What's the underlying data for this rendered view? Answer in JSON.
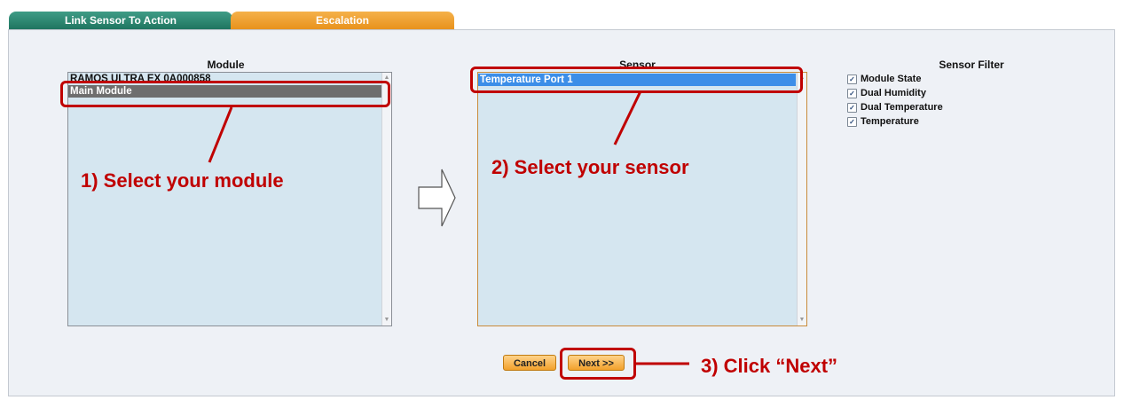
{
  "tabs": [
    {
      "label": "Link Sensor To Action"
    },
    {
      "label": "Escalation"
    }
  ],
  "module": {
    "title": "Module",
    "items": [
      "RAMOS ULTRA EX 0A000858",
      "Main Module"
    ],
    "selected_index": 1
  },
  "sensor": {
    "title": "Sensor",
    "items": [
      "Temperature Port 1"
    ],
    "selected_index": 0
  },
  "sensor_filter": {
    "title": "Sensor Filter",
    "options": [
      {
        "label": "Module State",
        "checked": true
      },
      {
        "label": "Dual Humidity",
        "checked": true
      },
      {
        "label": "Dual Temperature",
        "checked": true
      },
      {
        "label": "Temperature",
        "checked": true
      }
    ]
  },
  "buttons": {
    "cancel": "Cancel",
    "next": "Next >>"
  },
  "annotations": {
    "step1": "1) Select your module",
    "step2": "2) Select your sensor",
    "step3": "3) Click “Next”"
  },
  "colors": {
    "tab_active": "#1f7560",
    "tab_escalation": "#e8921c",
    "listbox_bg": "#d5e6f0",
    "selected_module": "#6e6e6e",
    "selected_sensor": "#3c8ee8",
    "annotation": "#c00000"
  }
}
